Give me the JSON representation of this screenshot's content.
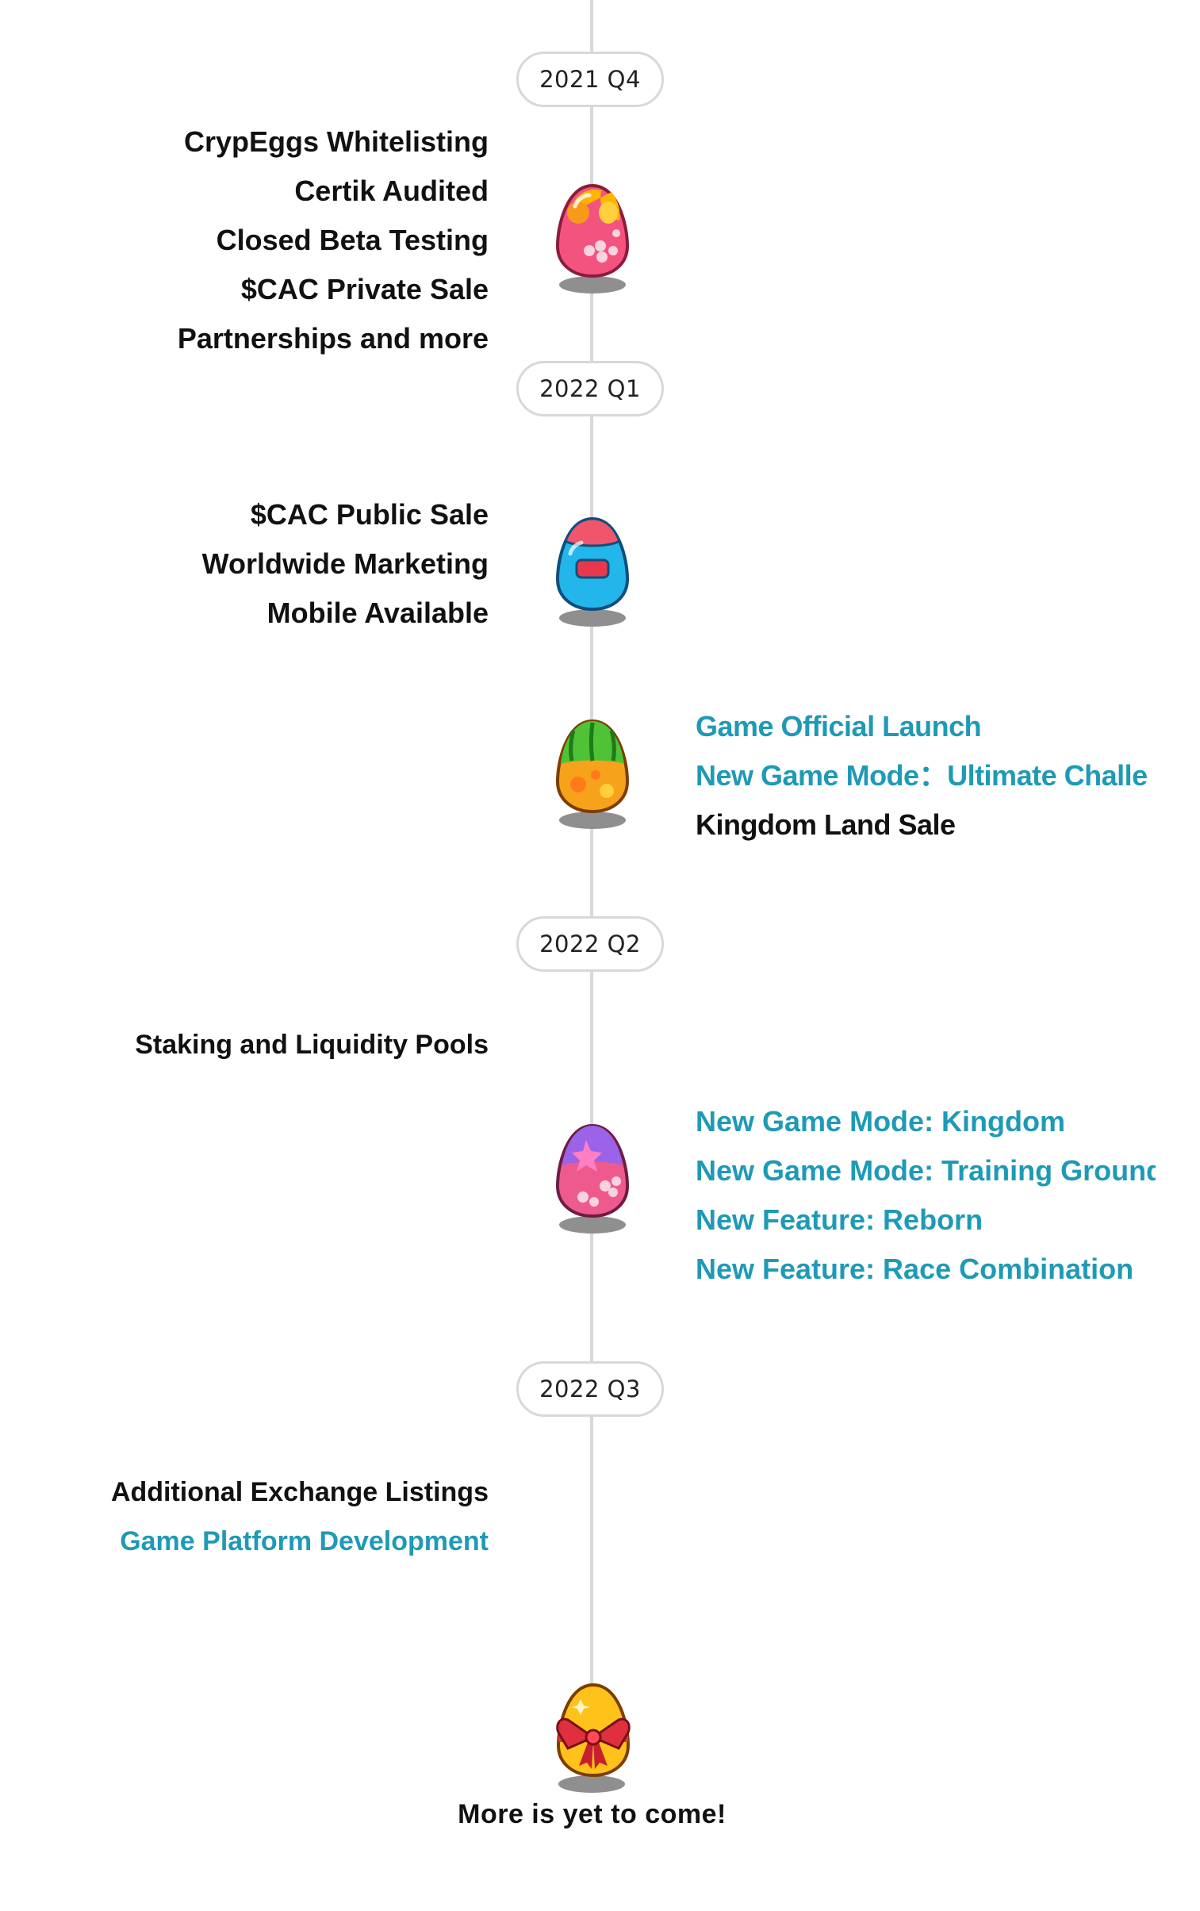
{
  "colors": {
    "accent": "#1e9ab6",
    "text": "#111111",
    "line": "#d8d8d8"
  },
  "milestones": [
    {
      "label": "2021 Q4",
      "items": [
        {
          "text": "CrypEggs Whitelisting",
          "color": "#111111"
        },
        {
          "text": "Certik Audited",
          "color": "#111111"
        },
        {
          "text": "Closed Beta Testing",
          "color": "#111111"
        },
        {
          "text": "$CAC Private Sale",
          "color": "#111111"
        },
        {
          "text": "Partnerships and more",
          "color": "#111111"
        }
      ],
      "egg_icon": "pink-spotted-egg-icon"
    },
    {
      "label": "2022 Q1",
      "items": [
        {
          "text": "$CAC Public Sale",
          "color": "#111111"
        },
        {
          "text": "Worldwide Marketing",
          "color": "#111111"
        },
        {
          "text": "Mobile Available",
          "color": "#111111"
        }
      ],
      "egg_icon": "blue-capsule-egg-icon",
      "items_right": [
        {
          "text": "Game Official Launch",
          "color": "#1e9ab6"
        },
        {
          "text": "New Game Mode：Ultimate Challe",
          "color": "#1e9ab6"
        },
        {
          "text": "Kingdom Land Sale",
          "color": "#111111"
        }
      ],
      "egg_icon_right": "watermelon-egg-icon"
    },
    {
      "label": "2022 Q2",
      "items": [
        {
          "text": "Staking and Liquidity Pools",
          "color": "#111111"
        }
      ],
      "items_right": [
        {
          "text": "New Game Mode: Kingdom",
          "color": "#1e9ab6"
        },
        {
          "text": "New Game Mode: Training Ground",
          "color": "#1e9ab6"
        },
        {
          "text": "New Feature: Reborn",
          "color": "#1e9ab6"
        },
        {
          "text": "New Feature: Race Combination",
          "color": "#1e9ab6"
        }
      ],
      "egg_icon": "purple-star-egg-icon"
    },
    {
      "label": "2022 Q3",
      "items": [
        {
          "text": "Additional Exchange Listings",
          "color": "#111111"
        },
        {
          "text": "Game Platform Development",
          "color": "#1e9ab6"
        }
      ],
      "egg_icon": "gift-egg-icon"
    }
  ],
  "final_text": "More is yet to come!"
}
